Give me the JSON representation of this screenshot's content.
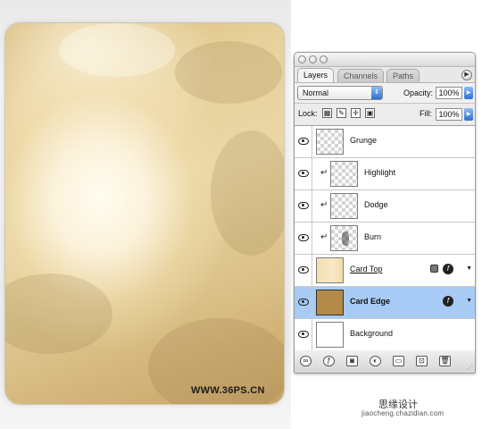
{
  "canvas": {
    "watermark": "WWW.36PS.CN"
  },
  "panel": {
    "tabs": [
      {
        "label": "Layers",
        "active": true
      },
      {
        "label": "Channels",
        "active": false
      },
      {
        "label": "Paths",
        "active": false
      }
    ],
    "blend_mode": "Normal",
    "opacity_label": "Opacity:",
    "opacity_value": "100%",
    "lock_label": "Lock:",
    "fill_label": "Fill:",
    "fill_value": "100%",
    "layers": [
      {
        "name": "Grunge",
        "clipped": false,
        "thumb": "transparent",
        "visible": true,
        "selected": false
      },
      {
        "name": "Highlight",
        "clipped": true,
        "thumb": "transparent",
        "visible": true,
        "selected": false
      },
      {
        "name": "Dodge",
        "clipped": true,
        "thumb": "transparent",
        "visible": true,
        "selected": false
      },
      {
        "name": "Burn",
        "clipped": true,
        "thumb": "burn",
        "visible": true,
        "selected": false
      },
      {
        "name": "Card Top",
        "clipped": false,
        "thumb": "card-top",
        "visible": true,
        "selected": false,
        "locked": true,
        "has_effects": true
      },
      {
        "name": "Card Edge",
        "clipped": false,
        "thumb": "card-edge",
        "visible": true,
        "selected": true,
        "has_effects": true
      },
      {
        "name": "Background",
        "clipped": false,
        "thumb": "white",
        "visible": true,
        "selected": false
      }
    ],
    "colors": {
      "selected_row": "#a7cbf5",
      "accent_blue": "#2d6fd2"
    }
  },
  "footer": {
    "site_text": "思缘设计",
    "site_url": "jiaocheng.chazidian.com"
  }
}
